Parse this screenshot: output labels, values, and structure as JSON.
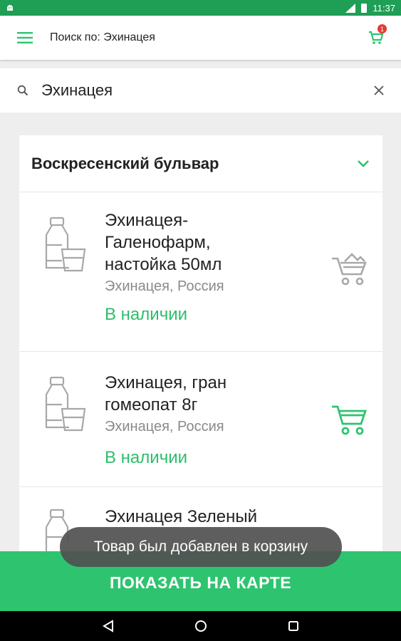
{
  "status_bar": {
    "time": "11:37"
  },
  "toolbar": {
    "title": "Поиск по: Эхинацея",
    "cart_count": "1"
  },
  "search": {
    "query": "Эхинацея"
  },
  "pharmacy": {
    "name": "Воскресенский бульвар",
    "items": [
      {
        "name_lines": [
          "Эхинацея-",
          "Галенофарм,",
          "настойка  50мл"
        ],
        "maker": "Эхинацея, Россия",
        "stock": "В наличии",
        "cart_state": "inactive"
      },
      {
        "name_lines": [
          "Эхинацея, гран",
          "гомеопат 8г"
        ],
        "maker": "Эхинацея, Россия",
        "stock": "В наличии",
        "cart_state": "active"
      },
      {
        "name_lines": [
          "Эхинацея Зеленый"
        ],
        "maker": "",
        "stock": "",
        "cart_state": ""
      }
    ]
  },
  "toast": "Товар был добавлен в корзину",
  "map_button": "ПОКАЗАТЬ НА КАРТЕ",
  "icons": {
    "menu": "hamburger-icon",
    "cart": "cart-icon",
    "search": "search-icon",
    "clear": "close-icon",
    "chevron": "chevron-down-icon",
    "bottle": "medicine-bottle-icon",
    "add_to_cart": "add-to-cart-icon",
    "nav_back": "back-triangle-icon",
    "nav_home": "home-circle-icon",
    "nav_recents": "recents-square-icon"
  },
  "colors": {
    "brand_green": "#2ec46f",
    "status_green": "#1f9f55",
    "stock_green": "#2ebd6b",
    "badge_red": "#e53935"
  }
}
